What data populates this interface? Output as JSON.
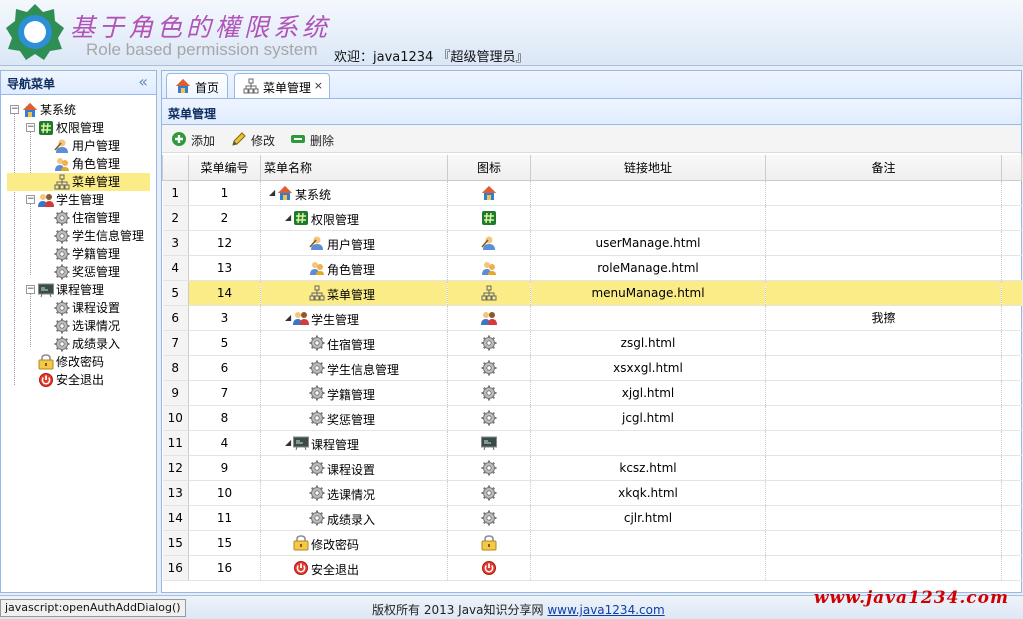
{
  "header": {
    "title_cn": "基于角色的權限系统",
    "title_en": "Role based permission system",
    "welcome": "欢迎：java1234 『超级管理员』"
  },
  "sidebar": {
    "title": "导航菜单",
    "collapse_icon": "double-chevron-left-icon",
    "tree": [
      {
        "label": "某系统",
        "icon": "home-icon"
      },
      {
        "label": "权限管理",
        "icon": "hash-icon"
      },
      {
        "label": "用户管理",
        "icon": "user-icon"
      },
      {
        "label": "角色管理",
        "icon": "users-icon"
      },
      {
        "label": "菜单管理",
        "icon": "org-chart-icon"
      },
      {
        "label": "学生管理",
        "icon": "students-icon"
      },
      {
        "label": "住宿管理",
        "icon": "gear-icon"
      },
      {
        "label": "学生信息管理",
        "icon": "gear-icon"
      },
      {
        "label": "学籍管理",
        "icon": "gear-icon"
      },
      {
        "label": "奖惩管理",
        "icon": "gear-icon"
      },
      {
        "label": "课程管理",
        "icon": "chalkboard-icon"
      },
      {
        "label": "课程设置",
        "icon": "gear-icon"
      },
      {
        "label": "选课情况",
        "icon": "gear-icon"
      },
      {
        "label": "成绩录入",
        "icon": "gear-icon"
      },
      {
        "label": "修改密码",
        "icon": "lock-icon"
      },
      {
        "label": "安全退出",
        "icon": "exit-icon"
      }
    ]
  },
  "tabs": [
    {
      "label": "首页",
      "icon": "home-icon"
    },
    {
      "label": "菜单管理",
      "icon": "org-chart-icon",
      "close": "×"
    }
  ],
  "panel": {
    "title": "菜单管理"
  },
  "toolbar": {
    "add": "添加",
    "edit": "修改",
    "delete": "删除"
  },
  "table": {
    "headers": [
      "菜单编号",
      "菜单名称",
      "图标",
      "链接地址",
      "备注"
    ],
    "rows": [
      {
        "rn": "1",
        "id": "1",
        "name": "某系统",
        "icon": "home-icon",
        "url": "",
        "note": ""
      },
      {
        "rn": "2",
        "id": "2",
        "name": "权限管理",
        "icon": "hash-icon",
        "url": "",
        "note": ""
      },
      {
        "rn": "3",
        "id": "12",
        "name": "用户管理",
        "icon": "user-icon",
        "url": "userManage.html",
        "note": ""
      },
      {
        "rn": "4",
        "id": "13",
        "name": "角色管理",
        "icon": "users-icon",
        "url": "roleManage.html",
        "note": ""
      },
      {
        "rn": "5",
        "id": "14",
        "name": "菜单管理",
        "icon": "org-chart-icon",
        "url": "menuManage.html",
        "note": ""
      },
      {
        "rn": "6",
        "id": "3",
        "name": "学生管理",
        "icon": "students-icon",
        "url": "",
        "note": "我擦"
      },
      {
        "rn": "7",
        "id": "5",
        "name": "住宿管理",
        "icon": "gear-icon",
        "url": "zsgl.html",
        "note": ""
      },
      {
        "rn": "8",
        "id": "6",
        "name": "学生信息管理",
        "icon": "gear-icon",
        "url": "xsxxgl.html",
        "note": ""
      },
      {
        "rn": "9",
        "id": "7",
        "name": "学籍管理",
        "icon": "gear-icon",
        "url": "xjgl.html",
        "note": ""
      },
      {
        "rn": "10",
        "id": "8",
        "name": "奖惩管理",
        "icon": "gear-icon",
        "url": "jcgl.html",
        "note": ""
      },
      {
        "rn": "11",
        "id": "4",
        "name": "课程管理",
        "icon": "chalkboard-icon",
        "url": "",
        "note": ""
      },
      {
        "rn": "12",
        "id": "9",
        "name": "课程设置",
        "icon": "gear-icon",
        "url": "kcsz.html",
        "note": ""
      },
      {
        "rn": "13",
        "id": "10",
        "name": "选课情况",
        "icon": "gear-icon",
        "url": "xkqk.html",
        "note": ""
      },
      {
        "rn": "14",
        "id": "11",
        "name": "成绩录入",
        "icon": "gear-icon",
        "url": "cjlr.html",
        "note": ""
      },
      {
        "rn": "15",
        "id": "15",
        "name": "修改密码",
        "icon": "lock-icon",
        "url": "",
        "note": ""
      },
      {
        "rn": "16",
        "id": "16",
        "name": "安全退出",
        "icon": "exit-icon",
        "url": "",
        "note": ""
      }
    ]
  },
  "footer": {
    "status": "javascript:openAuthAddDialog()",
    "copyright": "版权所有 2013 Java知识分享网",
    "link": "www.java1234.com",
    "watermark": "www.java1234.com"
  },
  "colors": {
    "selected_row": "#fbec88",
    "panel_border": "#95b8e7",
    "title_purple": "#b054b8",
    "watermark_red": "#d10000"
  }
}
